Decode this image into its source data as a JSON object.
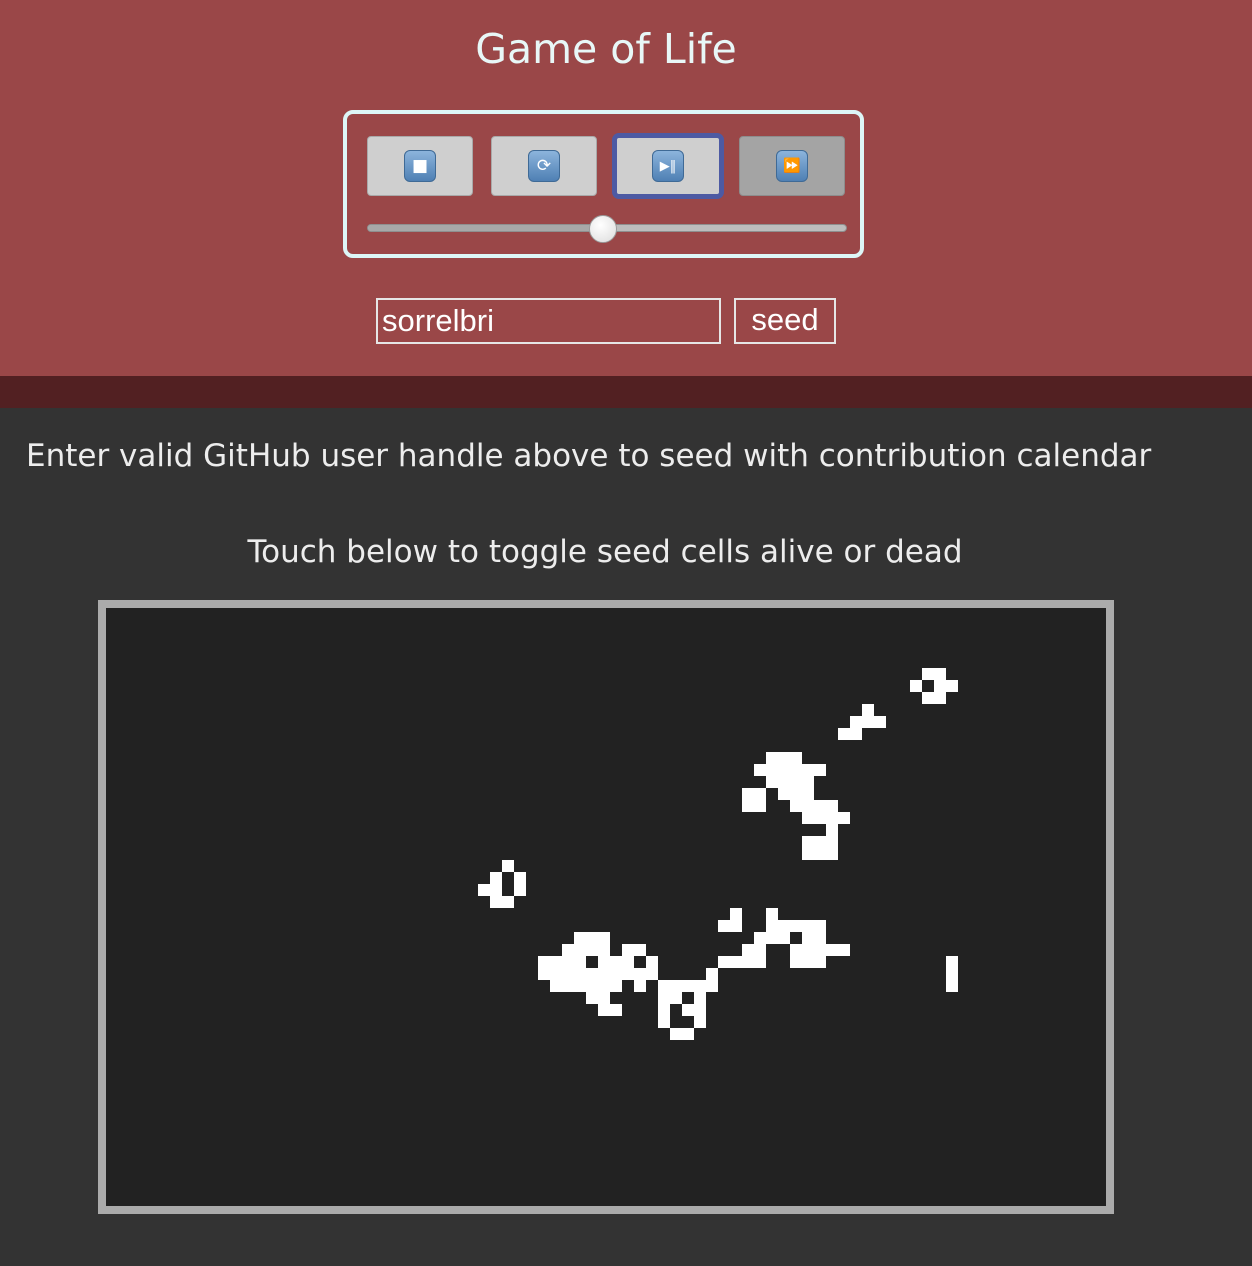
{
  "app": {
    "title": "Game of Life"
  },
  "controls": {
    "buttons": [
      {
        "name": "stop",
        "icon": "stop-icon",
        "glyph": "■"
      },
      {
        "name": "reset",
        "icon": "refresh-icon",
        "glyph": "⟳"
      },
      {
        "name": "play-pause",
        "icon": "play-pause-icon",
        "glyph": "▶‖",
        "active": true
      },
      {
        "name": "fast-forward",
        "icon": "fast-forward-icon",
        "glyph": "⏩",
        "disabled": true
      }
    ],
    "speed_slider": {
      "value": 0.49
    }
  },
  "seed_form": {
    "handle_value": "sorrelbri",
    "seed_label": "seed"
  },
  "instructions": {
    "github_hint": "Enter valid GitHub user handle above to seed with contribution calendar",
    "toggle_hint": "Touch below to toggle seed cells alive or dead"
  },
  "board": {
    "cell_color": "#ffffff",
    "background": "#222222",
    "live_cells": [
      [
        68,
        5
      ],
      [
        69,
        5
      ],
      [
        67,
        6
      ],
      [
        69,
        6
      ],
      [
        70,
        6
      ],
      [
        68,
        7
      ],
      [
        69,
        7
      ],
      [
        63,
        8
      ],
      [
        62,
        9
      ],
      [
        63,
        9
      ],
      [
        64,
        9
      ],
      [
        61,
        10
      ],
      [
        62,
        10
      ],
      [
        55,
        12
      ],
      [
        56,
        12
      ],
      [
        57,
        12
      ],
      [
        54,
        13
      ],
      [
        55,
        13
      ],
      [
        56,
        13
      ],
      [
        57,
        13
      ],
      [
        58,
        13
      ],
      [
        59,
        13
      ],
      [
        55,
        14
      ],
      [
        56,
        14
      ],
      [
        57,
        14
      ],
      [
        58,
        14
      ],
      [
        53,
        15
      ],
      [
        54,
        15
      ],
      [
        56,
        15
      ],
      [
        57,
        15
      ],
      [
        58,
        15
      ],
      [
        53,
        16
      ],
      [
        54,
        16
      ],
      [
        57,
        16
      ],
      [
        58,
        16
      ],
      [
        59,
        16
      ],
      [
        60,
        16
      ],
      [
        58,
        17
      ],
      [
        59,
        17
      ],
      [
        60,
        17
      ],
      [
        61,
        17
      ],
      [
        60,
        18
      ],
      [
        58,
        19
      ],
      [
        59,
        19
      ],
      [
        60,
        19
      ],
      [
        58,
        20
      ],
      [
        59,
        20
      ],
      [
        60,
        20
      ],
      [
        33,
        21
      ],
      [
        32,
        22
      ],
      [
        34,
        22
      ],
      [
        31,
        23
      ],
      [
        32,
        23
      ],
      [
        34,
        23
      ],
      [
        32,
        24
      ],
      [
        33,
        24
      ],
      [
        52,
        25
      ],
      [
        55,
        25
      ],
      [
        51,
        26
      ],
      [
        52,
        26
      ],
      [
        55,
        26
      ],
      [
        56,
        26
      ],
      [
        57,
        26
      ],
      [
        58,
        26
      ],
      [
        59,
        26
      ],
      [
        39,
        27
      ],
      [
        40,
        27
      ],
      [
        41,
        27
      ],
      [
        54,
        27
      ],
      [
        55,
        27
      ],
      [
        56,
        27
      ],
      [
        58,
        27
      ],
      [
        59,
        27
      ],
      [
        38,
        28
      ],
      [
        39,
        28
      ],
      [
        40,
        28
      ],
      [
        41,
        28
      ],
      [
        43,
        28
      ],
      [
        44,
        28
      ],
      [
        53,
        28
      ],
      [
        54,
        28
      ],
      [
        57,
        28
      ],
      [
        58,
        28
      ],
      [
        59,
        28
      ],
      [
        60,
        28
      ],
      [
        61,
        28
      ],
      [
        36,
        29
      ],
      [
        37,
        29
      ],
      [
        38,
        29
      ],
      [
        39,
        29
      ],
      [
        41,
        29
      ],
      [
        42,
        29
      ],
      [
        43,
        29
      ],
      [
        45,
        29
      ],
      [
        51,
        29
      ],
      [
        52,
        29
      ],
      [
        53,
        29
      ],
      [
        54,
        29
      ],
      [
        57,
        29
      ],
      [
        58,
        29
      ],
      [
        59,
        29
      ],
      [
        70,
        29
      ],
      [
        36,
        30
      ],
      [
        37,
        30
      ],
      [
        38,
        30
      ],
      [
        39,
        30
      ],
      [
        40,
        30
      ],
      [
        41,
        30
      ],
      [
        42,
        30
      ],
      [
        43,
        30
      ],
      [
        44,
        30
      ],
      [
        45,
        30
      ],
      [
        50,
        30
      ],
      [
        70,
        30
      ],
      [
        37,
        31
      ],
      [
        38,
        31
      ],
      [
        39,
        31
      ],
      [
        40,
        31
      ],
      [
        41,
        31
      ],
      [
        42,
        31
      ],
      [
        44,
        31
      ],
      [
        46,
        31
      ],
      [
        47,
        31
      ],
      [
        48,
        31
      ],
      [
        49,
        31
      ],
      [
        50,
        31
      ],
      [
        70,
        31
      ],
      [
        40,
        32
      ],
      [
        41,
        32
      ],
      [
        46,
        32
      ],
      [
        47,
        32
      ],
      [
        49,
        32
      ],
      [
        41,
        33
      ],
      [
        42,
        33
      ],
      [
        46,
        33
      ],
      [
        48,
        33
      ],
      [
        49,
        33
      ],
      [
        46,
        34
      ],
      [
        49,
        34
      ],
      [
        47,
        35
      ],
      [
        48,
        35
      ]
    ]
  }
}
